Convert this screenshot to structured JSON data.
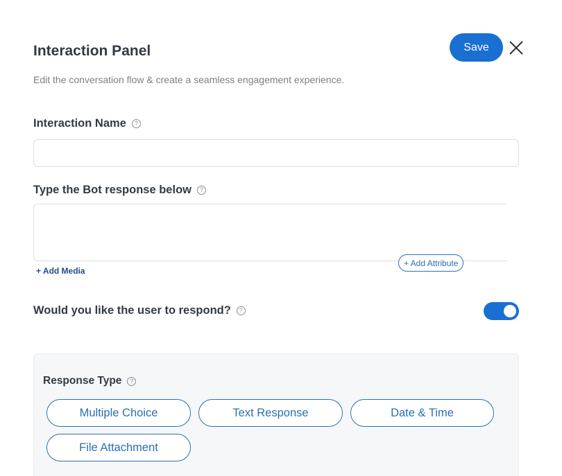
{
  "header": {
    "title": "Interaction Panel",
    "subtitle": "Edit the conversation flow & create a seamless engagement experience.",
    "save_label": "Save",
    "close_icon": "close-icon"
  },
  "interaction_name": {
    "label": "Interaction Name",
    "value": "",
    "help_icon": "help-icon"
  },
  "bot_response": {
    "label": "Type the Bot response below",
    "value": "",
    "add_attribute_label": "+ Add Attribute",
    "add_media_label": "+ Add Media"
  },
  "user_respond": {
    "label": "Would you like the user to respond?",
    "toggle_on": true
  },
  "response_type": {
    "label": "Response Type",
    "options": [
      "Multiple Choice",
      "Text Response",
      "Date & Time",
      "File Attachment"
    ]
  },
  "colors": {
    "accent": "#1a6fd3",
    "chip_border": "#2b6fb3"
  }
}
